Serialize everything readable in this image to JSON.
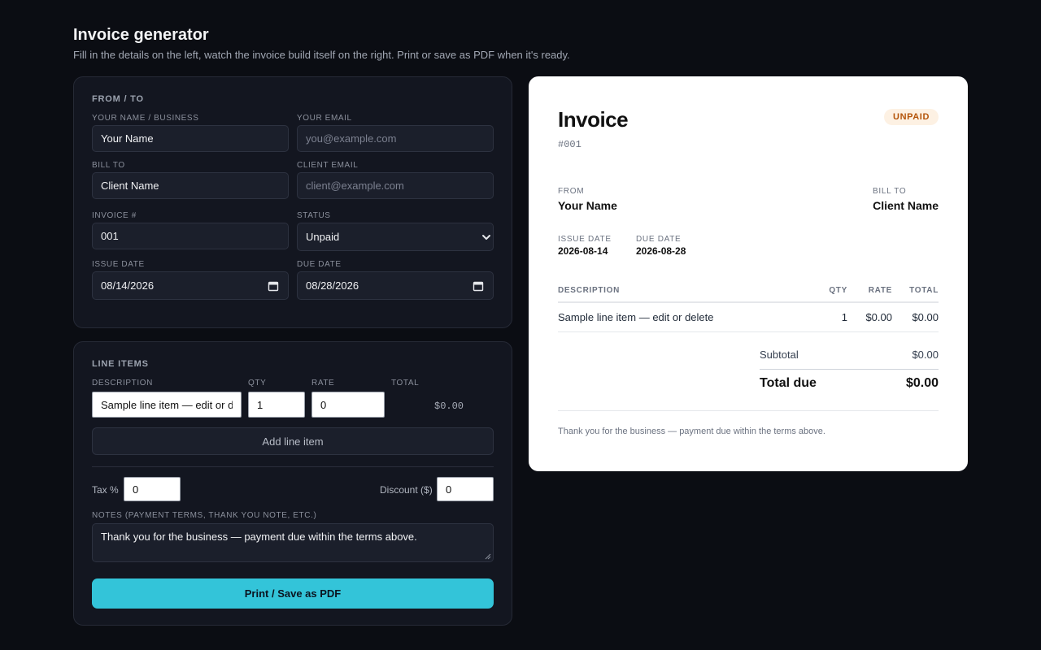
{
  "page": {
    "title": "Invoice generator",
    "subtitle": "Fill in the details on the left, watch the invoice build itself on the right. Print or save as PDF when it's ready."
  },
  "form": {
    "section_title": "FROM / TO",
    "name_label": "YOUR NAME / BUSINESS",
    "name_value": "Your Name",
    "email_label": "YOUR EMAIL",
    "email_placeholder": "you@example.com",
    "billto_label": "BILL TO",
    "billto_value": "Client Name",
    "client_email_label": "CLIENT EMAIL",
    "client_email_placeholder": "client@example.com",
    "invoice_num_label": "INVOICE #",
    "invoice_num_value": "001",
    "status_label": "STATUS",
    "status_value": "Unpaid",
    "issue_date_label": "ISSUE DATE",
    "issue_date_value": "08/14/2026",
    "due_date_label": "DUE DATE",
    "due_date_value": "08/28/2026"
  },
  "line_items": {
    "section_title": "LINE ITEMS",
    "headers": {
      "description": "DESCRIPTION",
      "qty": "QTY",
      "rate": "RATE",
      "total": "TOTAL"
    },
    "items": [
      {
        "description": "Sample line item — edit or de",
        "qty": "1",
        "rate": "0",
        "total": "$0.00"
      }
    ],
    "add_label": "Add line item",
    "tax_label": "Tax %",
    "tax_value": "0",
    "discount_label": "Discount ($)",
    "discount_value": "0",
    "notes_label": "NOTES (PAYMENT TERMS, THANK YOU NOTE, ETC.)",
    "notes_value": "Thank you for the business — payment due within the terms above.",
    "print_label": "Print / Save as PDF"
  },
  "invoice": {
    "title": "Invoice",
    "number": "#001",
    "status_badge": "UNPAID",
    "from_label": "FROM",
    "from_value": "Your Name",
    "billto_label": "BILL TO",
    "billto_value": "Client Name",
    "issue_label": "ISSUE DATE",
    "issue_value": "2026-08-14",
    "due_label": "DUE DATE",
    "due_value": "2026-08-28",
    "columns": {
      "description": "DESCRIPTION",
      "qty": "QTY",
      "rate": "RATE",
      "total": "TOTAL"
    },
    "rows": [
      {
        "description": "Sample line item — edit or delete",
        "qty": "1",
        "rate": "$0.00",
        "total": "$0.00"
      }
    ],
    "subtotal_label": "Subtotal",
    "subtotal_value": "$0.00",
    "total_due_label": "Total due",
    "total_due_value": "$0.00",
    "notes": "Thank you for the business — payment due within the terms above."
  },
  "colors": {
    "background": "#0b0d13",
    "card": "#131620",
    "accent": "#33c4d9",
    "badge_text": "#b45309",
    "badge_bg": "#fdf1e3"
  }
}
